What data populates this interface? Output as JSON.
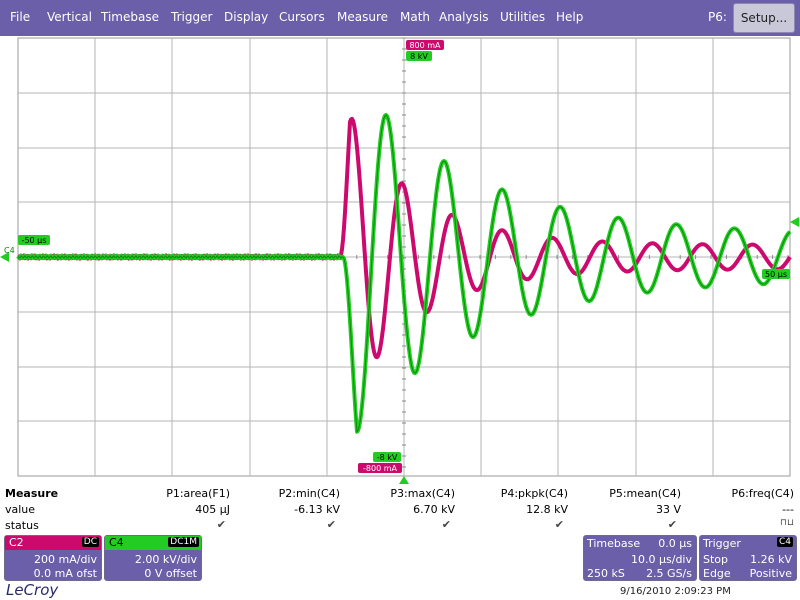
{
  "menu": {
    "items": [
      "File",
      "Vertical",
      "Timebase",
      "Trigger",
      "Display",
      "Cursors",
      "Measure",
      "Math",
      "Analysis",
      "Utilities",
      "Help"
    ],
    "p6_label": "P6:",
    "setup_label": "Setup..."
  },
  "colors": {
    "menubar": "#6a5fa8",
    "c2": "#cc0a6e",
    "c4": "#22cc22",
    "grid": "#b4b4b4"
  },
  "markers": {
    "c2_top": "800 mA",
    "c4_top": "8 kV",
    "c4_bottom": "-8 kV",
    "c2_bottom": "-800 mA",
    "left_time": "-50 µs",
    "left_channel": "C4",
    "right_time": "50 µs"
  },
  "measure": {
    "title": "Measure",
    "row_labels": [
      "value",
      "status"
    ],
    "params": [
      {
        "header": "P1:area(F1)",
        "value": "405 µJ",
        "status": "✔"
      },
      {
        "header": "P2:min(C4)",
        "value": "-6.13 kV",
        "status": "✔"
      },
      {
        "header": "P3:max(C4)",
        "value": "6.70 kV",
        "status": "✔"
      },
      {
        "header": "P4:pkpk(C4)",
        "value": "12.8 kV",
        "status": "✔"
      },
      {
        "header": "P5:mean(C4)",
        "value": "33 V",
        "status": "✔"
      },
      {
        "header": "P6:freq(C4)",
        "value": "---",
        "status": "⊓⊔"
      }
    ]
  },
  "channels": {
    "c2": {
      "name": "C2",
      "coupling": "DC",
      "vdiv": "200 mA/div",
      "offset": "0.0 mA ofst"
    },
    "c4": {
      "name": "C4",
      "coupling": "DC1M",
      "vdiv": "2.00 kV/div",
      "offset": "0 V offset"
    }
  },
  "timebase": {
    "label": "Timebase",
    "delay": "0.0 µs",
    "tdiv": "10.0 µs/div",
    "samples": "250 kS",
    "rate": "2.5 GS/s"
  },
  "trigger": {
    "label": "Trigger",
    "source": "C4",
    "mode": "Stop",
    "level": "1.26 kV",
    "type": "Edge",
    "slope": "Positive"
  },
  "footer": {
    "brand": "LeCroy",
    "timestamp": "9/16/2010 2:09:23 PM"
  }
}
